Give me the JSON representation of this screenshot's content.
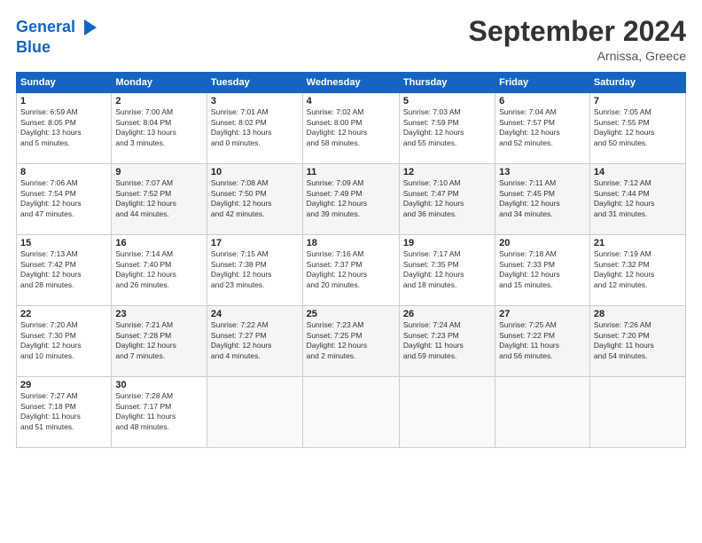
{
  "header": {
    "logo_line1": "General",
    "logo_line2": "Blue",
    "month": "September 2024",
    "location": "Arnissa, Greece"
  },
  "weekdays": [
    "Sunday",
    "Monday",
    "Tuesday",
    "Wednesday",
    "Thursday",
    "Friday",
    "Saturday"
  ],
  "weeks": [
    [
      {
        "day": "1",
        "info": "Sunrise: 6:59 AM\nSunset: 8:05 PM\nDaylight: 13 hours\nand 5 minutes."
      },
      {
        "day": "2",
        "info": "Sunrise: 7:00 AM\nSunset: 8:04 PM\nDaylight: 13 hours\nand 3 minutes."
      },
      {
        "day": "3",
        "info": "Sunrise: 7:01 AM\nSunset: 8:02 PM\nDaylight: 13 hours\nand 0 minutes."
      },
      {
        "day": "4",
        "info": "Sunrise: 7:02 AM\nSunset: 8:00 PM\nDaylight: 12 hours\nand 58 minutes."
      },
      {
        "day": "5",
        "info": "Sunrise: 7:03 AM\nSunset: 7:59 PM\nDaylight: 12 hours\nand 55 minutes."
      },
      {
        "day": "6",
        "info": "Sunrise: 7:04 AM\nSunset: 7:57 PM\nDaylight: 12 hours\nand 52 minutes."
      },
      {
        "day": "7",
        "info": "Sunrise: 7:05 AM\nSunset: 7:55 PM\nDaylight: 12 hours\nand 50 minutes."
      }
    ],
    [
      {
        "day": "8",
        "info": "Sunrise: 7:06 AM\nSunset: 7:54 PM\nDaylight: 12 hours\nand 47 minutes."
      },
      {
        "day": "9",
        "info": "Sunrise: 7:07 AM\nSunset: 7:52 PM\nDaylight: 12 hours\nand 44 minutes."
      },
      {
        "day": "10",
        "info": "Sunrise: 7:08 AM\nSunset: 7:50 PM\nDaylight: 12 hours\nand 42 minutes."
      },
      {
        "day": "11",
        "info": "Sunrise: 7:09 AM\nSunset: 7:49 PM\nDaylight: 12 hours\nand 39 minutes."
      },
      {
        "day": "12",
        "info": "Sunrise: 7:10 AM\nSunset: 7:47 PM\nDaylight: 12 hours\nand 36 minutes."
      },
      {
        "day": "13",
        "info": "Sunrise: 7:11 AM\nSunset: 7:45 PM\nDaylight: 12 hours\nand 34 minutes."
      },
      {
        "day": "14",
        "info": "Sunrise: 7:12 AM\nSunset: 7:44 PM\nDaylight: 12 hours\nand 31 minutes."
      }
    ],
    [
      {
        "day": "15",
        "info": "Sunrise: 7:13 AM\nSunset: 7:42 PM\nDaylight: 12 hours\nand 28 minutes."
      },
      {
        "day": "16",
        "info": "Sunrise: 7:14 AM\nSunset: 7:40 PM\nDaylight: 12 hours\nand 26 minutes."
      },
      {
        "day": "17",
        "info": "Sunrise: 7:15 AM\nSunset: 7:38 PM\nDaylight: 12 hours\nand 23 minutes."
      },
      {
        "day": "18",
        "info": "Sunrise: 7:16 AM\nSunset: 7:37 PM\nDaylight: 12 hours\nand 20 minutes."
      },
      {
        "day": "19",
        "info": "Sunrise: 7:17 AM\nSunset: 7:35 PM\nDaylight: 12 hours\nand 18 minutes."
      },
      {
        "day": "20",
        "info": "Sunrise: 7:18 AM\nSunset: 7:33 PM\nDaylight: 12 hours\nand 15 minutes."
      },
      {
        "day": "21",
        "info": "Sunrise: 7:19 AM\nSunset: 7:32 PM\nDaylight: 12 hours\nand 12 minutes."
      }
    ],
    [
      {
        "day": "22",
        "info": "Sunrise: 7:20 AM\nSunset: 7:30 PM\nDaylight: 12 hours\nand 10 minutes."
      },
      {
        "day": "23",
        "info": "Sunrise: 7:21 AM\nSunset: 7:28 PM\nDaylight: 12 hours\nand 7 minutes."
      },
      {
        "day": "24",
        "info": "Sunrise: 7:22 AM\nSunset: 7:27 PM\nDaylight: 12 hours\nand 4 minutes."
      },
      {
        "day": "25",
        "info": "Sunrise: 7:23 AM\nSunset: 7:25 PM\nDaylight: 12 hours\nand 2 minutes."
      },
      {
        "day": "26",
        "info": "Sunrise: 7:24 AM\nSunset: 7:23 PM\nDaylight: 11 hours\nand 59 minutes."
      },
      {
        "day": "27",
        "info": "Sunrise: 7:25 AM\nSunset: 7:22 PM\nDaylight: 11 hours\nand 56 minutes."
      },
      {
        "day": "28",
        "info": "Sunrise: 7:26 AM\nSunset: 7:20 PM\nDaylight: 11 hours\nand 54 minutes."
      }
    ],
    [
      {
        "day": "29",
        "info": "Sunrise: 7:27 AM\nSunset: 7:18 PM\nDaylight: 11 hours\nand 51 minutes."
      },
      {
        "day": "30",
        "info": "Sunrise: 7:28 AM\nSunset: 7:17 PM\nDaylight: 11 hours\nand 48 minutes."
      },
      {
        "day": "",
        "info": ""
      },
      {
        "day": "",
        "info": ""
      },
      {
        "day": "",
        "info": ""
      },
      {
        "day": "",
        "info": ""
      },
      {
        "day": "",
        "info": ""
      }
    ]
  ]
}
